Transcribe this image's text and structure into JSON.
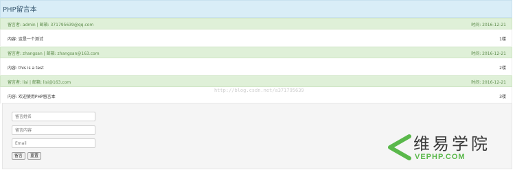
{
  "header": {
    "title": "PHP留言本"
  },
  "messages": [
    {
      "who": "留言者: admin | 邮箱: 371795639@qq.com",
      "time": "时间: 2016-12-21",
      "content": "内容: 这是一个测试",
      "floor": "1楼"
    },
    {
      "who": "留言者: zhangsan | 邮箱: zhangsan@163.com",
      "time": "时间: 2016-12-21",
      "content": "内容: this is a test",
      "floor": "2楼"
    },
    {
      "who": "留言者: lisi | 邮箱: lisi@163.com",
      "time": "时间: 2016-12-21",
      "content": "内容: 欢迎使用PHP留言本",
      "floor": "3楼"
    }
  ],
  "watermark": "http://blog.csdn.net/a371795639",
  "form": {
    "name_placeholder": "留言姓名",
    "content_placeholder": "留言内容",
    "email_placeholder": "Email",
    "submit_label": "留言",
    "reset_label": "重置"
  },
  "logo": {
    "cn": "维易学院",
    "en": "VEPHP.COM",
    "accent_color": "#5ab84b"
  }
}
